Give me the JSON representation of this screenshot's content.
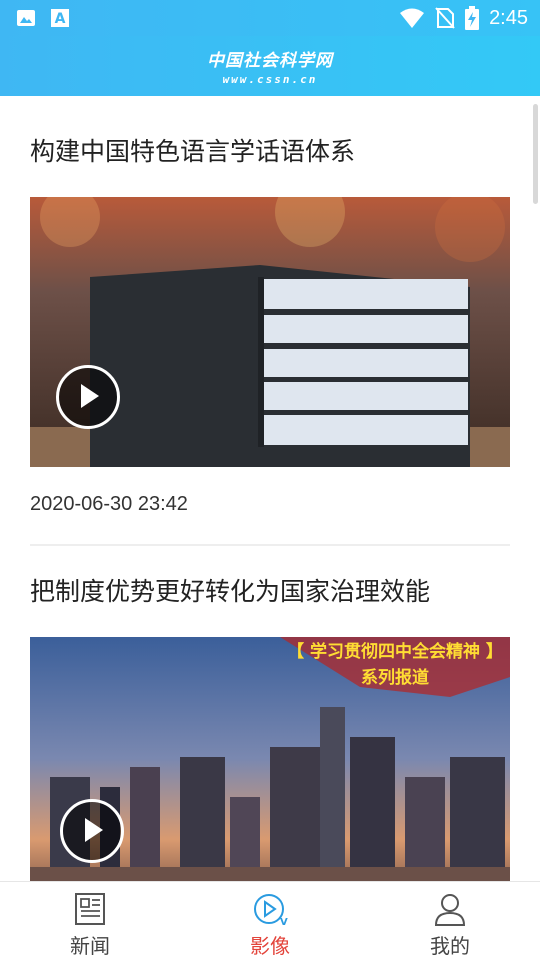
{
  "status": {
    "time": "2:45"
  },
  "header": {
    "logo_text": "中国社会科学网",
    "logo_url": "www.cssn.cn"
  },
  "articles": [
    {
      "title": "构建中国特色语言学话语体系",
      "date": "2020-06-30  23:42"
    },
    {
      "title": "把制度优势更好转化为国家治理效能",
      "banner_line1": "【 学习贯彻四中全会精神 】",
      "banner_line2": "系列报道"
    }
  ],
  "nav": {
    "items": [
      {
        "label": "新闻",
        "icon": "newspaper-icon"
      },
      {
        "label": "影像",
        "icon": "play-video-icon",
        "active": true
      },
      {
        "label": "我的",
        "icon": "person-icon"
      }
    ]
  },
  "colors": {
    "header": "#3fb7f3",
    "active": "#e3443b",
    "inactive": "#444444"
  }
}
